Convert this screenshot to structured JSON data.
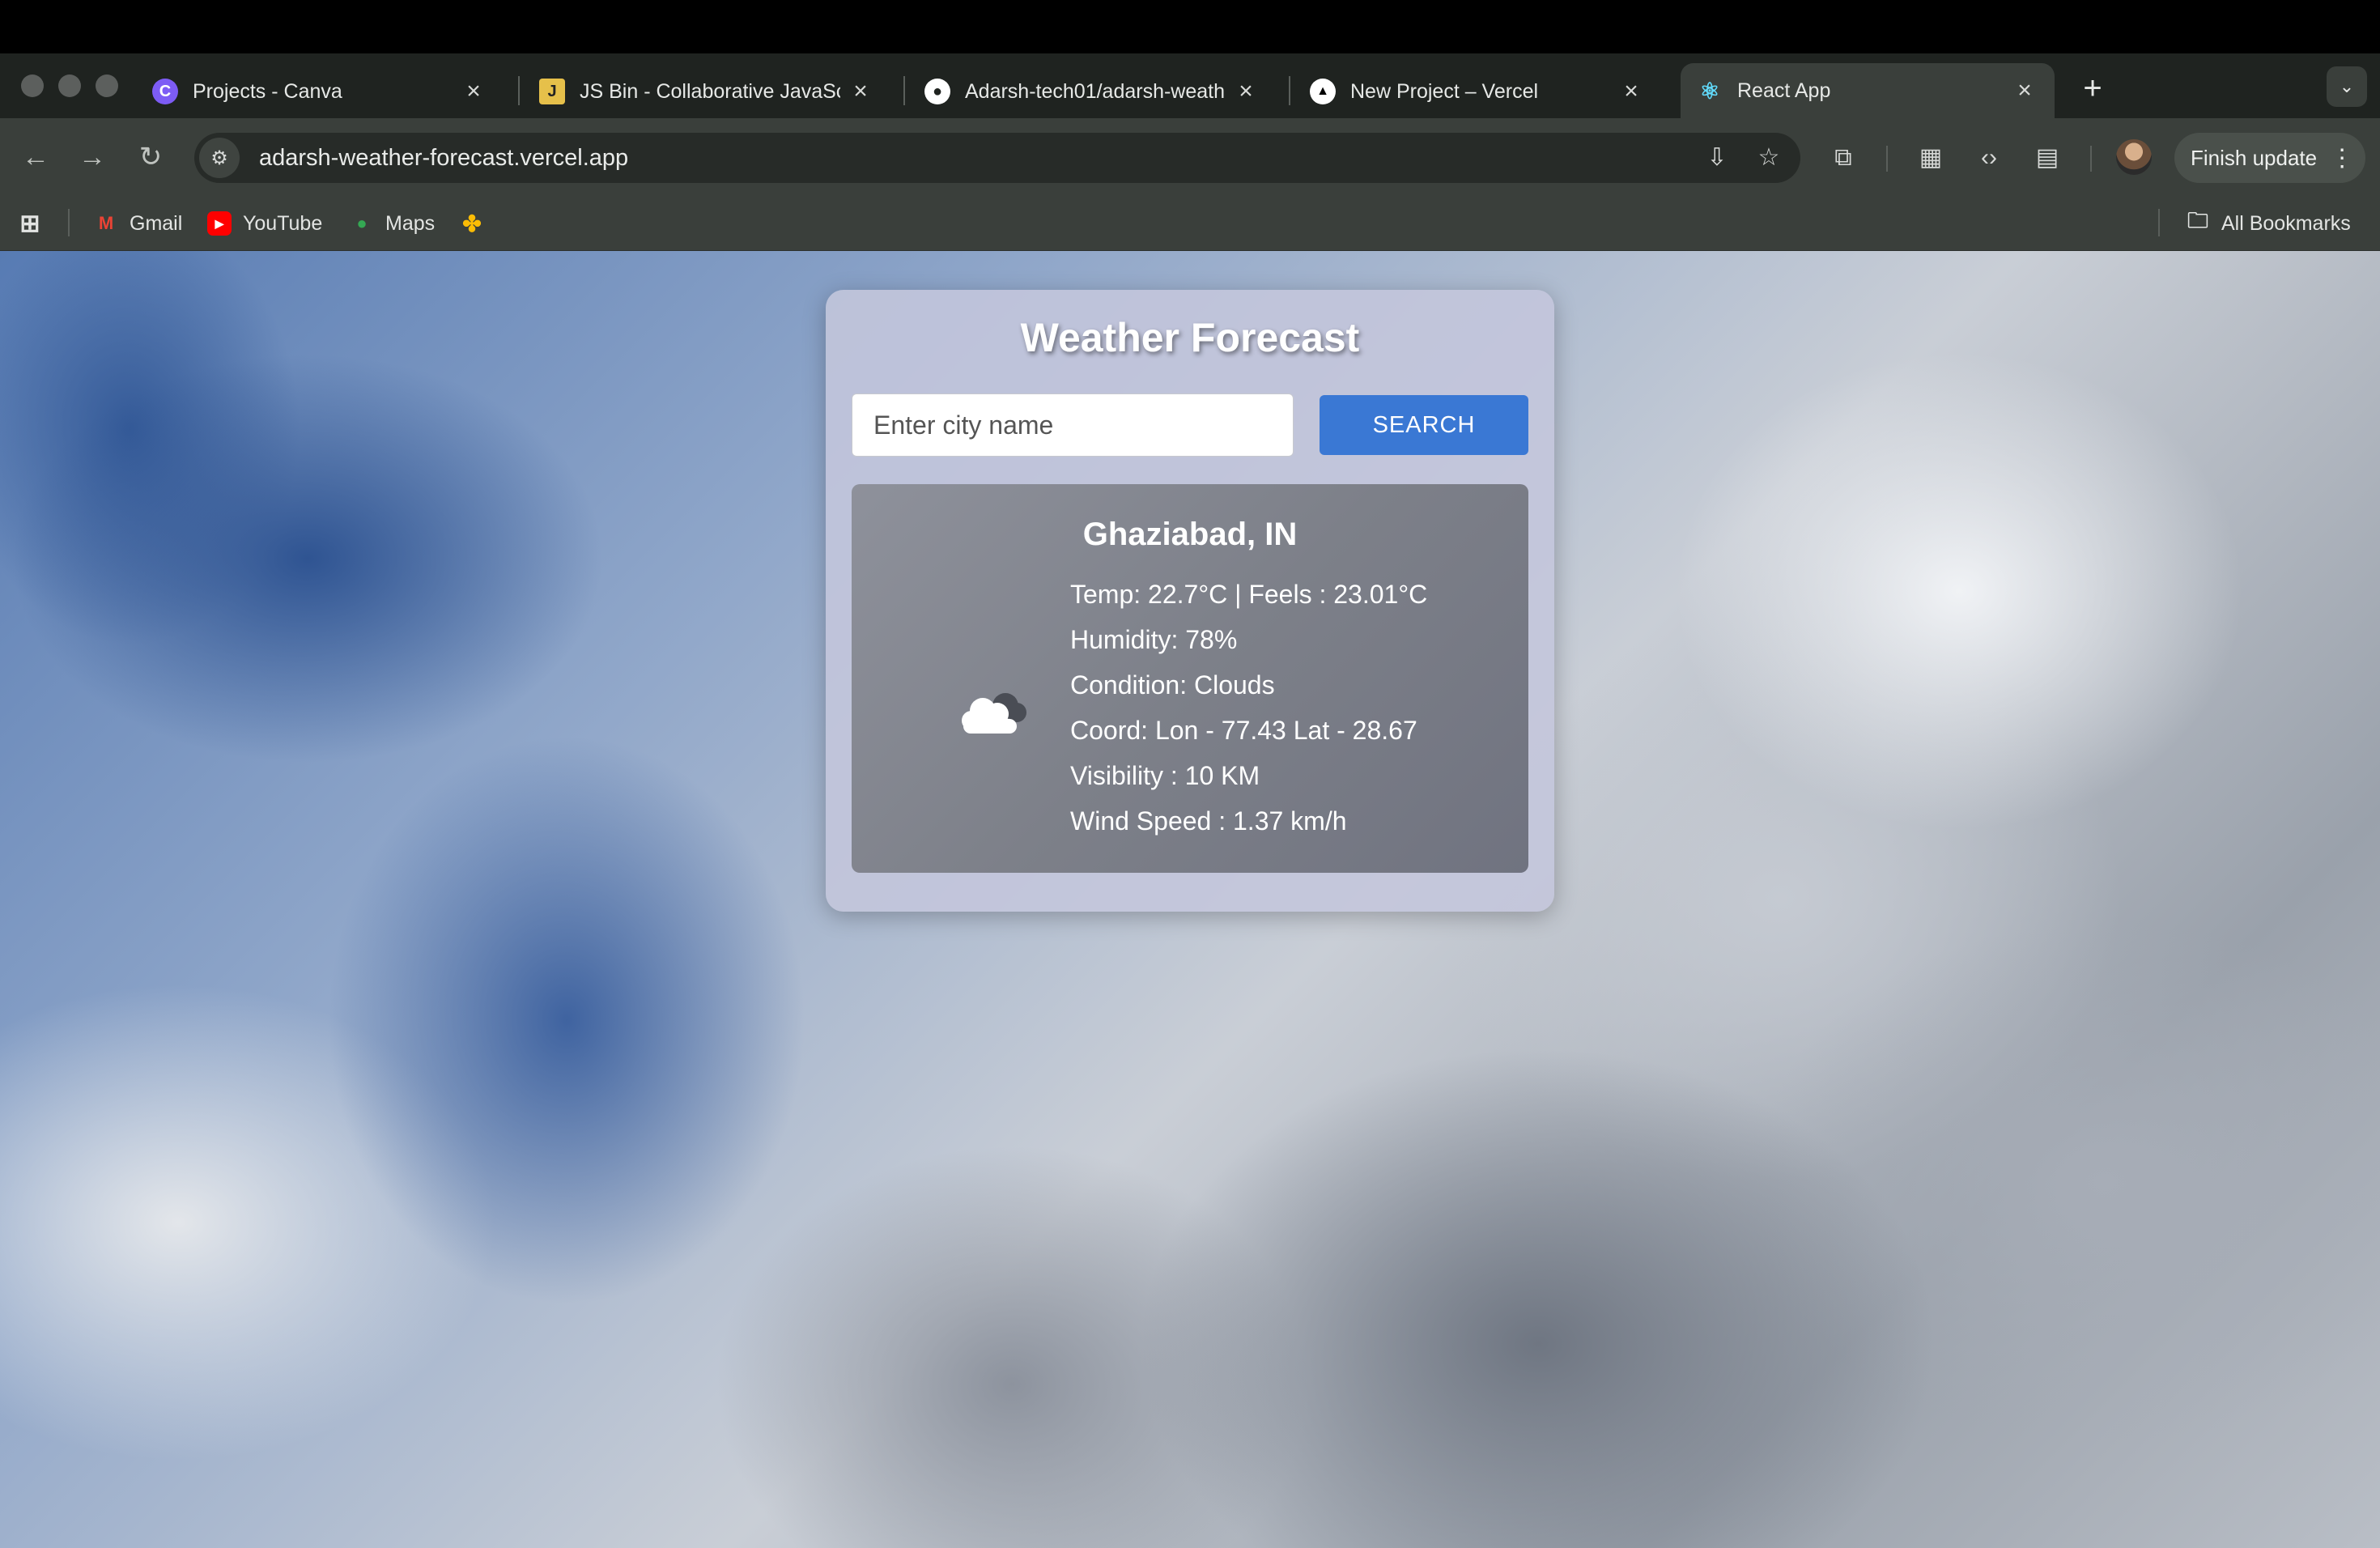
{
  "browser": {
    "tabs": [
      {
        "title": "Projects - Canva",
        "favicon": "canva-icon",
        "color": "#7d5cf5"
      },
      {
        "title": "JS Bin - Collaborative JavaSc",
        "favicon": "jsbin-icon",
        "color": "#e6c04a"
      },
      {
        "title": "Adarsh-tech01/adarsh-weath",
        "favicon": "github-icon",
        "color": "#ffffff"
      },
      {
        "title": "New Project – Vercel",
        "favicon": "vercel-icon",
        "color": "#ffffff"
      },
      {
        "title": "React App",
        "favicon": "react-icon",
        "color": "#61dafb",
        "active": true
      }
    ],
    "url": "adarsh-weather-forecast.vercel.app",
    "finish_update_label": "Finish update",
    "bookmarks": [
      {
        "label": "Gmail",
        "icon": "gmail-icon"
      },
      {
        "label": "YouTube",
        "icon": "youtube-icon"
      },
      {
        "label": "Maps",
        "icon": "maps-icon"
      },
      {
        "label": "",
        "icon": "photos-icon"
      }
    ],
    "all_bookmarks_label": "All Bookmarks"
  },
  "app": {
    "title": "Weather Forecast",
    "search": {
      "placeholder": "Enter city name",
      "value": "",
      "button_label": "SEARCH"
    },
    "weather": {
      "location": "Ghaziabad, IN",
      "icon": "cloud-icon",
      "lines": [
        "Temp: 22.7°C | Feels : 23.01°C",
        "Humidity: 78%",
        "Condition: Clouds",
        "Coord: Lon - 77.43 Lat - 28.67",
        "Visibility : 10 KM",
        "Wind Speed : 1.37 km/h"
      ]
    },
    "colors": {
      "accent": "#3a78d4",
      "card": "#c4c6dc",
      "result_panel": "#7d8089"
    }
  }
}
